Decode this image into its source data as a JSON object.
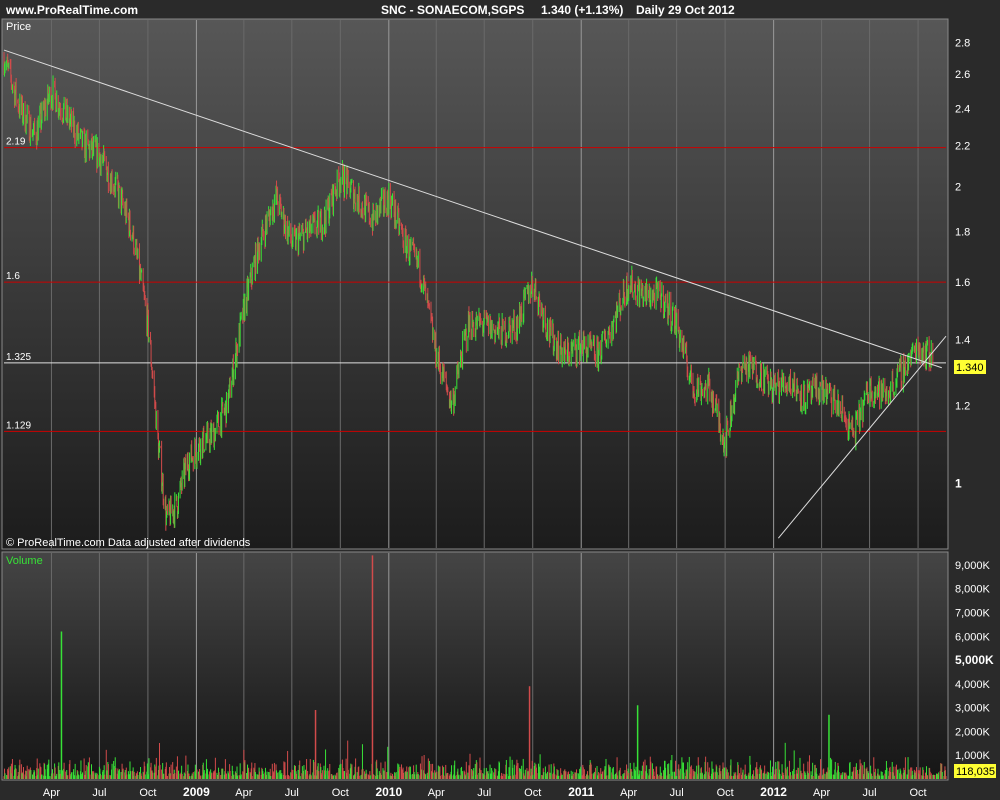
{
  "header": {
    "site": "www.ProRealTime.com",
    "instrument": "SNC - SONAECOM,SGPS",
    "quote": "1.340 (+1.13%)",
    "period": "Daily 29 Oct 2012"
  },
  "price_panel": {
    "label": "Price",
    "footer": "© ProRealTime.com Data adjusted after dividends",
    "last_price_label": "1.340",
    "hlines": [
      {
        "label": "2.19",
        "value": 2.19
      },
      {
        "label": "1.6",
        "value": 1.6
      },
      {
        "label": "1.325",
        "value": 1.325
      },
      {
        "label": "1.129",
        "value": 1.129
      }
    ]
  },
  "volume_panel": {
    "label": "Volume",
    "last_volume_label": "118,035"
  },
  "colors": {
    "background": "#2a2a2a",
    "panel_top": "#555555",
    "panel_bottom": "#1e1e1e",
    "up": "#37e237",
    "down": "#d24b4b",
    "level_line": "#cc0000",
    "trend_line": "#dddddd",
    "grid": "#6a6a6a"
  },
  "chart_data": [
    {
      "type": "line",
      "title": "SNC - SONAECOM,SGPS Daily",
      "ylabel": "Price",
      "y_scale": "log",
      "ylim": [
        0.86,
        2.95
      ],
      "y_ticks": [
        1,
        1.2,
        1.4,
        1.6,
        1.8,
        2,
        2.2,
        2.4,
        2.6,
        2.8
      ],
      "x_ticks": [
        "Apr",
        "Jul",
        "Oct",
        "2009",
        "Apr",
        "Jul",
        "Oct",
        "2010",
        "Apr",
        "Jul",
        "Oct",
        "2011",
        "Apr",
        "Jul",
        "Oct",
        "2012",
        "Apr",
        "Jul",
        "Oct"
      ],
      "x_tick_dates": [
        "2008-04",
        "2008-07",
        "2008-10",
        "2009-01",
        "2009-04",
        "2009-07",
        "2009-10",
        "2010-01",
        "2010-04",
        "2010-07",
        "2010-10",
        "2011-01",
        "2011-04",
        "2011-07",
        "2011-10",
        "2012-01",
        "2012-04",
        "2012-07",
        "2012-10"
      ],
      "x_range": [
        "2008-01-02",
        "2012-11-23"
      ],
      "series": [
        {
          "x": [
            "2008-01-02",
            "2008-02-01",
            "2008-03-01",
            "2008-04-01",
            "2008-05-01",
            "2008-06-01",
            "2008-07-01",
            "2008-08-01",
            "2008-09-01",
            "2008-10-01",
            "2008-10-20",
            "2008-11-05",
            "2008-11-25",
            "2008-12-15",
            "2009-01-10",
            "2009-02-01",
            "2009-03-01",
            "2009-04-01",
            "2009-05-01",
            "2009-06-01",
            "2009-07-01",
            "2009-08-01",
            "2009-09-01",
            "2009-10-01",
            "2009-11-01",
            "2009-12-01",
            "2010-01-01",
            "2010-02-01",
            "2010-03-01",
            "2010-04-01",
            "2010-05-01",
            "2010-06-01",
            "2010-07-01",
            "2010-08-01",
            "2010-09-01",
            "2010-10-01",
            "2010-11-01",
            "2010-12-01",
            "2011-01-01",
            "2011-02-01",
            "2011-03-01",
            "2011-04-01",
            "2011-05-01",
            "2011-06-01",
            "2011-07-01",
            "2011-08-01",
            "2011-09-01",
            "2011-10-01",
            "2011-11-01",
            "2011-12-01",
            "2012-01-01",
            "2012-02-01",
            "2012-03-01",
            "2012-04-01",
            "2012-05-01",
            "2012-06-01",
            "2012-07-01",
            "2012-08-01",
            "2012-09-01",
            "2012-10-01",
            "2012-10-29"
          ],
          "y": [
            2.7,
            2.4,
            2.25,
            2.5,
            2.35,
            2.2,
            2.15,
            2.0,
            1.8,
            1.45,
            1.1,
            0.92,
            0.95,
            1.05,
            1.1,
            1.12,
            1.2,
            1.5,
            1.75,
            1.95,
            1.75,
            1.8,
            1.85,
            2.05,
            1.95,
            1.85,
            1.95,
            1.75,
            1.65,
            1.35,
            1.2,
            1.45,
            1.45,
            1.42,
            1.45,
            1.6,
            1.42,
            1.35,
            1.38,
            1.35,
            1.45,
            1.6,
            1.55,
            1.55,
            1.45,
            1.25,
            1.25,
            1.1,
            1.32,
            1.3,
            1.25,
            1.27,
            1.22,
            1.25,
            1.2,
            1.12,
            1.25,
            1.23,
            1.3,
            1.38,
            1.34
          ]
        }
      ]
    },
    {
      "type": "bar",
      "ylabel": "Volume",
      "ylim": [
        0,
        9500
      ],
      "y_ticks_labels": [
        "1,000K",
        "2,000K",
        "3,000K",
        "4,000K",
        "5,000K",
        "6,000K",
        "7,000K",
        "8,000K",
        "9,000K"
      ],
      "y_ticks": [
        1000,
        2000,
        3000,
        4000,
        5000,
        6000,
        7000,
        8000,
        9000
      ],
      "spikes": [
        {
          "x": "2008-04-20",
          "value": 6200
        },
        {
          "x": "2009-12-01",
          "value": 9400
        },
        {
          "x": "2011-04-18",
          "value": 3100
        },
        {
          "x": "2010-09-25",
          "value": 3900
        },
        {
          "x": "2012-04-15",
          "value": 2700
        },
        {
          "x": "2009-08-15",
          "value": 2900
        }
      ],
      "last_value": 118035
    }
  ]
}
